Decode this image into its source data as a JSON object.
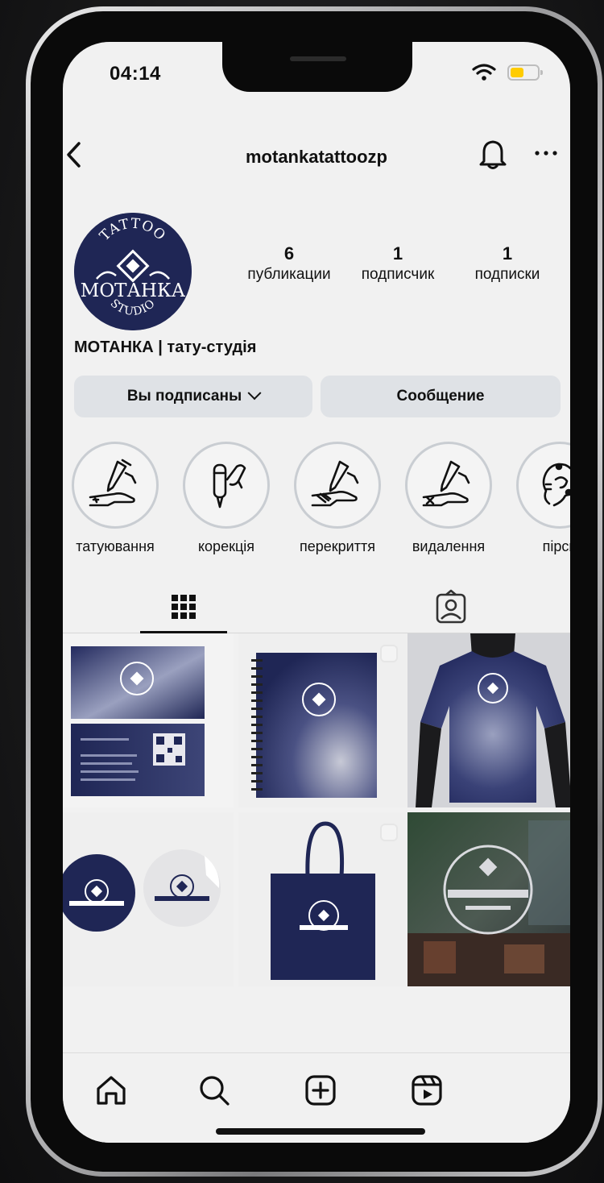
{
  "status_bar": {
    "time": "04:14"
  },
  "header": {
    "username": "motankatattoozp"
  },
  "profile": {
    "name": "МОТАНКА | тату-студія",
    "stats": [
      {
        "value": "6",
        "label": "публикации"
      },
      {
        "value": "1",
        "label": "подписчик"
      },
      {
        "value": "1",
        "label": "подписки"
      }
    ]
  },
  "actions": {
    "following_label": "Вы подписаны",
    "message_label": "Сообщение"
  },
  "highlights": [
    {
      "label": "татуювання"
    },
    {
      "label": "корекція"
    },
    {
      "label": "перекриття"
    },
    {
      "label": "видалення"
    },
    {
      "label": "пірси"
    }
  ],
  "logo": {
    "top": "TATTOO",
    "main": "МОТАНКА",
    "bottom": "STUDIO"
  },
  "colors": {
    "brand_navy": "#1f2655",
    "accent_yellow": "#ffcc00",
    "background": "#f1f1f1"
  },
  "icons": {
    "back": "chevron-left-icon",
    "bell": "bell-icon",
    "more": "more-horizontal-icon",
    "grid_tab": "grid-icon",
    "tagged_tab": "tagged-person-icon",
    "nav": [
      "home-icon",
      "search-icon",
      "create-icon",
      "reels-icon"
    ]
  }
}
